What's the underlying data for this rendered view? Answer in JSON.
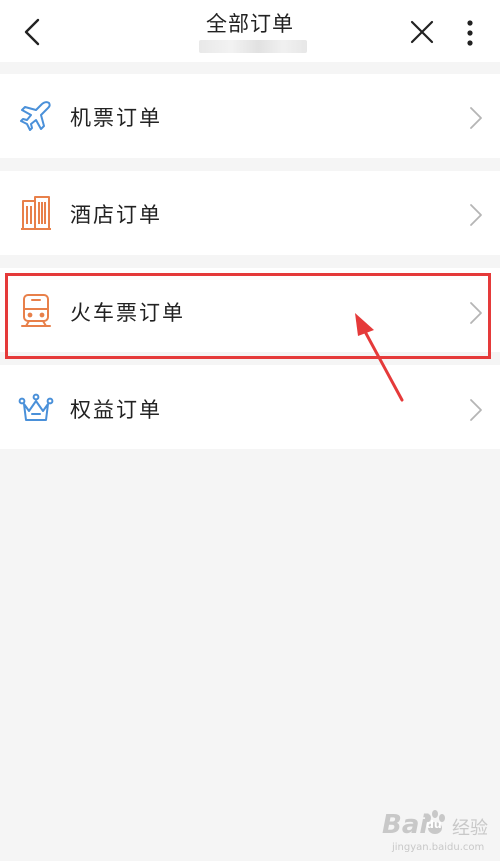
{
  "header": {
    "title": "全部订单"
  },
  "menu": [
    {
      "label": "机票订单",
      "icon": "airplane-icon",
      "color": "#4a90d9"
    },
    {
      "label": "酒店订单",
      "icon": "hotel-building-icon",
      "color": "#e8804a"
    },
    {
      "label": "火车票订单",
      "icon": "train-icon",
      "color": "#e8804a"
    },
    {
      "label": "权益订单",
      "icon": "crown-icon",
      "color": "#4a90d9"
    }
  ],
  "watermark": {
    "brand": "Bai",
    "paw": "du",
    "name": "经验",
    "url": "jingyan.baidu.com"
  },
  "colors": {
    "highlight": "#e53a3a",
    "background": "#f5f5f5",
    "blue_icon": "#4a90d9",
    "orange_icon": "#e8804a"
  }
}
